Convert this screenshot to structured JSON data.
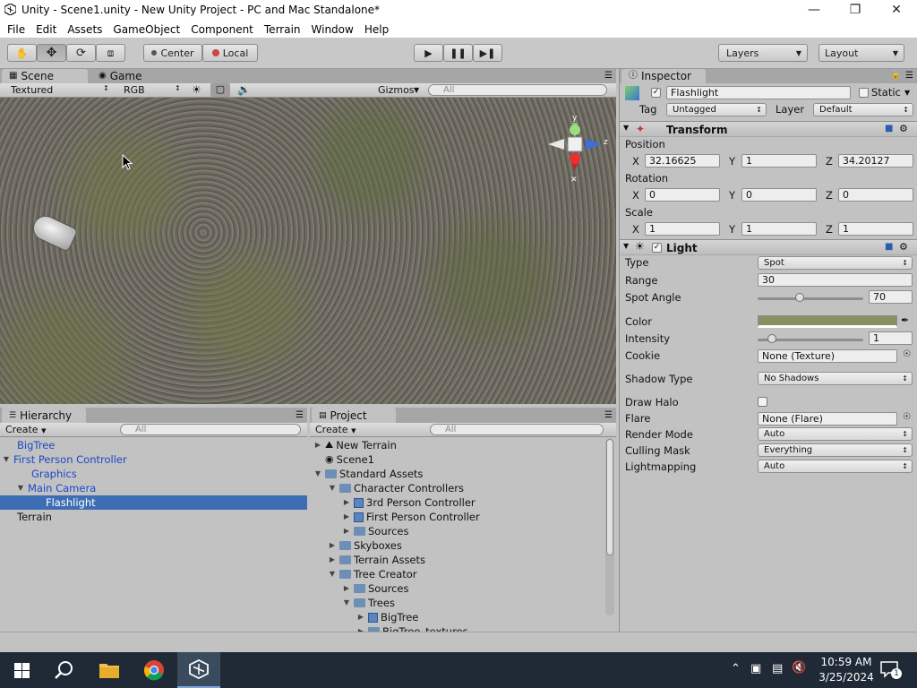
{
  "window": {
    "title": "Unity - Scene1.unity - New Unity Project - PC and Mac Standalone*",
    "minimize": "—",
    "maximize": "❐",
    "close": "✕"
  },
  "menu": [
    "File",
    "Edit",
    "Assets",
    "GameObject",
    "Component",
    "Terrain",
    "Window",
    "Help"
  ],
  "toolbar": {
    "pivot": "Center",
    "space": "Local",
    "layers": "Layers",
    "layout": "Layout"
  },
  "scene": {
    "tab_scene": "Scene",
    "tab_game": "Game",
    "render_mode": "Textured",
    "color_mode": "RGB",
    "gizmos": "Gizmos",
    "search_placeholder": "All",
    "axis_y": "y",
    "axis_z": "z"
  },
  "hierarchy": {
    "tab": "Hierarchy",
    "create": "Create",
    "search_placeholder": "All",
    "items": [
      {
        "label": "BigTree",
        "indent": 0,
        "blue": true,
        "expanded": null
      },
      {
        "label": "First Person Controller",
        "indent": 0,
        "blue": true,
        "expanded": true
      },
      {
        "label": "Graphics",
        "indent": 1,
        "blue": true,
        "expanded": null
      },
      {
        "label": "Main Camera",
        "indent": 1,
        "blue": true,
        "expanded": true
      },
      {
        "label": "Flashlight",
        "indent": 2,
        "blue": false,
        "selected": true
      },
      {
        "label": "Terrain",
        "indent": 0,
        "blue": false,
        "expanded": null
      }
    ]
  },
  "project": {
    "tab": "Project",
    "create": "Create",
    "search_placeholder": "All",
    "items": [
      {
        "label": "New Terrain",
        "indent": 0,
        "icon": "terrain-icon",
        "arrow": "right"
      },
      {
        "label": "Scene1",
        "indent": 0,
        "icon": "unity-scene-icon",
        "arrow": ""
      },
      {
        "label": "Standard Assets",
        "indent": 0,
        "icon": "folder-icon",
        "arrow": "down"
      },
      {
        "label": "Character Controllers",
        "indent": 1,
        "icon": "folder-icon",
        "arrow": "down"
      },
      {
        "label": "3rd Person Controller",
        "indent": 2,
        "icon": "prefab-icon",
        "arrow": "right"
      },
      {
        "label": "First Person Controller",
        "indent": 2,
        "icon": "prefab-icon",
        "arrow": "right"
      },
      {
        "label": "Sources",
        "indent": 2,
        "icon": "folder-icon",
        "arrow": "right"
      },
      {
        "label": "Skyboxes",
        "indent": 1,
        "icon": "folder-icon",
        "arrow": "right"
      },
      {
        "label": "Terrain Assets",
        "indent": 1,
        "icon": "folder-icon",
        "arrow": "right"
      },
      {
        "label": "Tree Creator",
        "indent": 1,
        "icon": "folder-icon",
        "arrow": "down"
      },
      {
        "label": "Sources",
        "indent": 2,
        "icon": "folder-icon",
        "arrow": "right"
      },
      {
        "label": "Trees",
        "indent": 2,
        "icon": "folder-icon",
        "arrow": "down"
      },
      {
        "label": "BigTree",
        "indent": 3,
        "icon": "prefab-icon",
        "arrow": "right"
      },
      {
        "label": "BigTree_textures",
        "indent": 3,
        "icon": "folder-icon",
        "arrow": "right"
      }
    ]
  },
  "inspector": {
    "tab": "Inspector",
    "object_name": "Flashlight",
    "static_label": "Static",
    "tag_label": "Tag",
    "tag_value": "Untagged",
    "layer_label": "Layer",
    "layer_value": "Default",
    "transform": {
      "title": "Transform",
      "position_label": "Position",
      "rotation_label": "Rotation",
      "scale_label": "Scale",
      "x_label": "X",
      "y_label": "Y",
      "z_label": "Z",
      "position": {
        "x": "32.16625",
        "y": "1",
        "z": "34.20127"
      },
      "rotation": {
        "x": "0",
        "y": "0",
        "z": "0"
      },
      "scale": {
        "x": "1",
        "y": "1",
        "z": "1"
      }
    },
    "light": {
      "title": "Light",
      "type_label": "Type",
      "type_value": "Spot",
      "range_label": "Range",
      "range_value": "30",
      "spot_angle_label": "Spot Angle",
      "spot_angle_value": "70",
      "color_label": "Color",
      "color_hex": "#8b8e61",
      "intensity_label": "Intensity",
      "intensity_value": "1",
      "cookie_label": "Cookie",
      "cookie_value": "None (Texture)",
      "shadow_label": "Shadow Type",
      "shadow_value": "No Shadows",
      "draw_halo_label": "Draw Halo",
      "flare_label": "Flare",
      "flare_value": "None (Flare)",
      "render_mode_label": "Render Mode",
      "render_mode_value": "Auto",
      "culling_label": "Culling Mask",
      "culling_value": "Everything",
      "lightmapping_label": "Lightmapping",
      "lightmapping_value": "Auto"
    }
  },
  "taskbar": {
    "time": "10:59 AM",
    "date": "3/25/2024",
    "notification_count": "1"
  },
  "colors": {
    "selection": "#3d6eb3",
    "link_blue": "#1b48c9",
    "taskbar": "#1f2a36"
  }
}
